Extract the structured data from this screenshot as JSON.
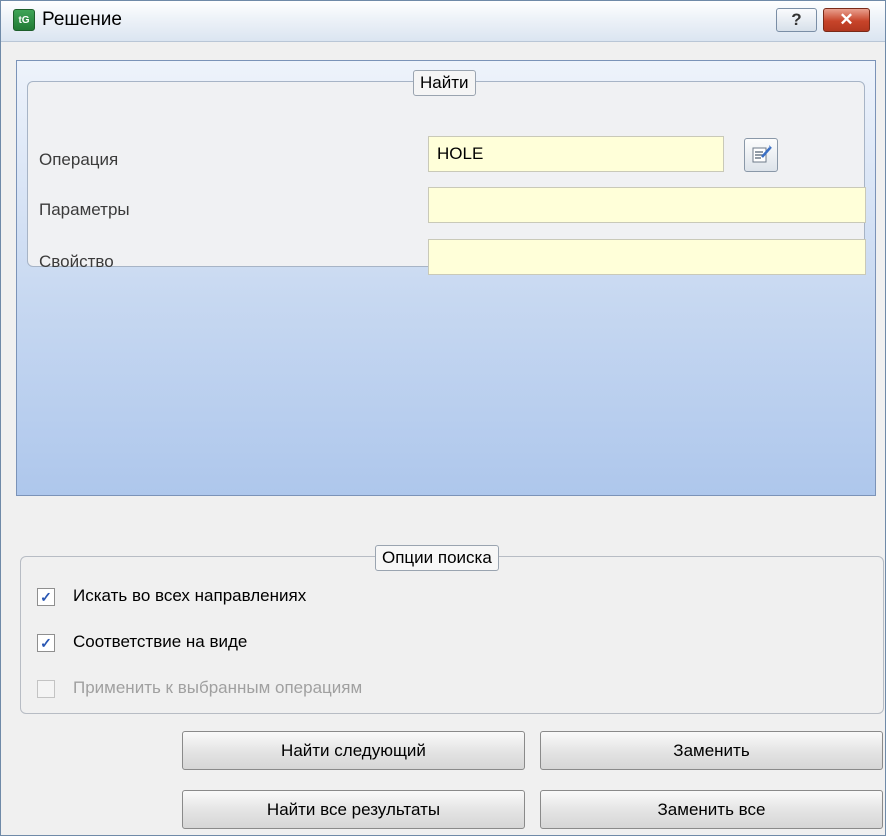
{
  "window": {
    "title": "Решение",
    "app_icon": "app-logo-icon",
    "help_button_label": "?",
    "close_button_label": "✕"
  },
  "find": {
    "legend": "Найти",
    "operation_label": "Операция",
    "operation_value": "HOLE",
    "parameters_label": "Параметры",
    "parameters_value": "",
    "property_label": "Свойство",
    "property_value": "",
    "pick_icon": "select-list-icon"
  },
  "search_options": {
    "legend": "Опции поиска",
    "items": [
      {
        "label": "Искать во всех направлениях",
        "checked": true,
        "enabled": true
      },
      {
        "label": "Соответствие на виде",
        "checked": true,
        "enabled": true
      },
      {
        "label": "Применить к выбранным операциям",
        "checked": false,
        "enabled": false
      }
    ]
  },
  "buttons": {
    "find_next": "Найти следующий",
    "replace": "Заменить",
    "find_all": "Найти все результаты",
    "replace_all": "Заменить все"
  },
  "colors": {
    "field_bg": "#ffffd9",
    "panel_blue": "#aec7ec",
    "close_red": "#c7442a",
    "checkmark": "#2a57b3"
  }
}
